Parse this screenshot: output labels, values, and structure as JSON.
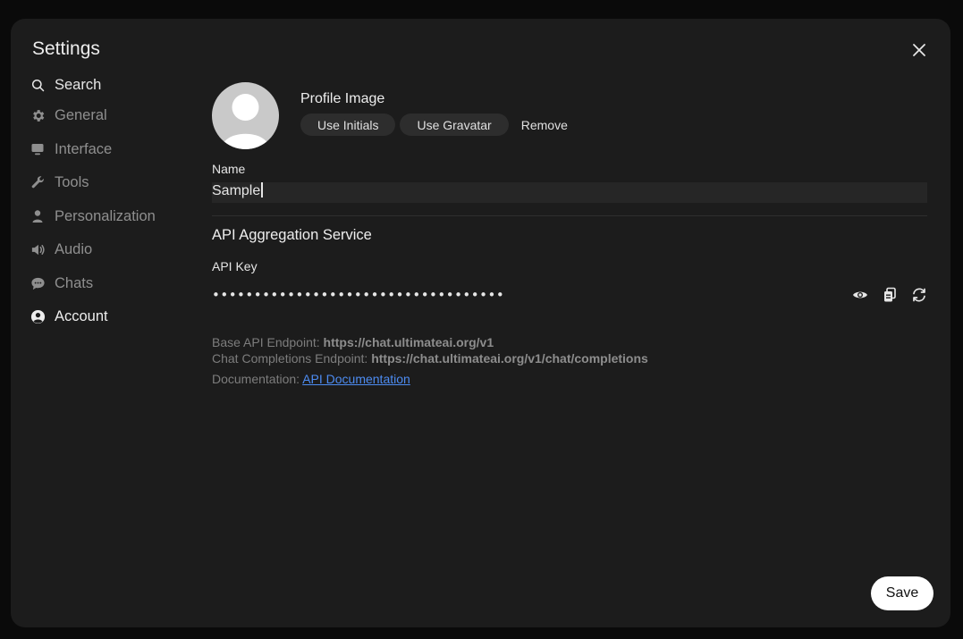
{
  "dialog": {
    "title": "Settings"
  },
  "sidebar": {
    "search_label": "Search",
    "items": [
      {
        "label": "General",
        "icon": "gear-icon"
      },
      {
        "label": "Interface",
        "icon": "monitor-icon"
      },
      {
        "label": "Tools",
        "icon": "wrench-icon"
      },
      {
        "label": "Personalization",
        "icon": "person-icon"
      },
      {
        "label": "Audio",
        "icon": "speaker-icon"
      },
      {
        "label": "Chats",
        "icon": "chat-bubble-icon"
      },
      {
        "label": "Account",
        "icon": "user-circle-icon",
        "active": true
      }
    ]
  },
  "profile": {
    "image_label": "Profile Image",
    "use_initials_label": "Use Initials",
    "use_gravatar_label": "Use Gravatar",
    "remove_label": "Remove",
    "name_label": "Name",
    "name_value": "Sample"
  },
  "api": {
    "section_title": "API Aggregation Service",
    "key_label": "API Key",
    "key_masked": "•••••••••••••••••••••••••••••••••••",
    "base_endpoint_label": "Base API Endpoint:",
    "base_endpoint_value": "https://chat.ultimateai.org/v1",
    "completions_endpoint_label": "Chat Completions Endpoint:",
    "completions_endpoint_value": "https://chat.ultimateai.org/v1/chat/completions",
    "documentation_label": "Documentation:",
    "documentation_link": "API Documentation"
  },
  "footer": {
    "save_label": "Save"
  },
  "colors": {
    "modal_bg": "#1c1c1c",
    "link": "#4d8cf2",
    "save_bg": "#ffffff"
  }
}
